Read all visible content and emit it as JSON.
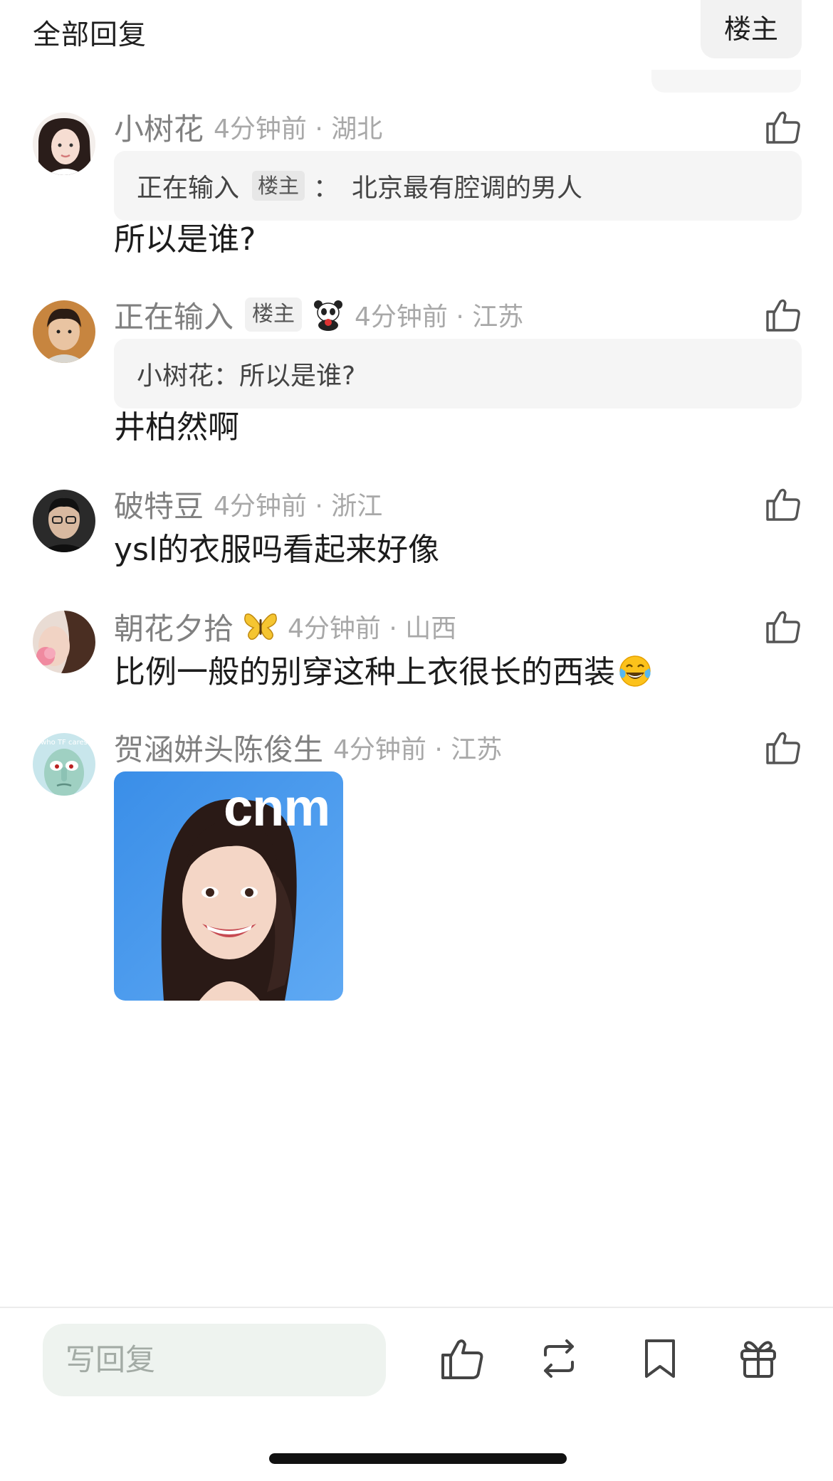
{
  "header": {
    "title": "全部回复",
    "op_filter_label": "楼主"
  },
  "comments": [
    {
      "username": "小树花",
      "time_location": "4分钟前 · 湖北",
      "quote": {
        "author": "正在输入",
        "author_badge": "楼主",
        "separator": "：",
        "text": "北京最有腔调的男人"
      },
      "text": "所以是谁?",
      "like_icon": "thumbs-up-icon"
    },
    {
      "username": "正在输入",
      "op_badge": "楼主",
      "badge_icon": "panda-badge-icon",
      "time_location": "4分钟前 · 江苏",
      "quote": {
        "text": "小树花：所以是谁?"
      },
      "text": "井柏然啊",
      "like_icon": "thumbs-up-icon"
    },
    {
      "username": "破特豆",
      "time_location": "4分钟前 · 浙江",
      "text": "ysl的衣服吗看起来好像",
      "like_icon": "thumbs-up-icon"
    },
    {
      "username": "朝花夕拾",
      "badge_icon": "butterfly-badge-icon",
      "time_location": "4分钟前 · 山西",
      "text": "比例一般的别穿这种上衣很长的西装",
      "emoji": "tears-of-joy-emoji",
      "like_icon": "thumbs-up-icon"
    },
    {
      "username": "贺涵姘头陈俊生",
      "time_location": "4分钟前 · 江苏",
      "sticker_text": "cnm",
      "avatar_caption": "who TF cares",
      "like_icon": "thumbs-up-icon"
    }
  ],
  "bottom_bar": {
    "reply_placeholder": "写回复",
    "icons": [
      "thumbs-up-icon",
      "repost-icon",
      "bookmark-icon",
      "gift-icon"
    ]
  },
  "colors": {
    "username": "#808080",
    "timestamp": "#a8a8a8",
    "quote_bg": "#f5f5f5",
    "reply_box_bg": "#eef3ef"
  }
}
